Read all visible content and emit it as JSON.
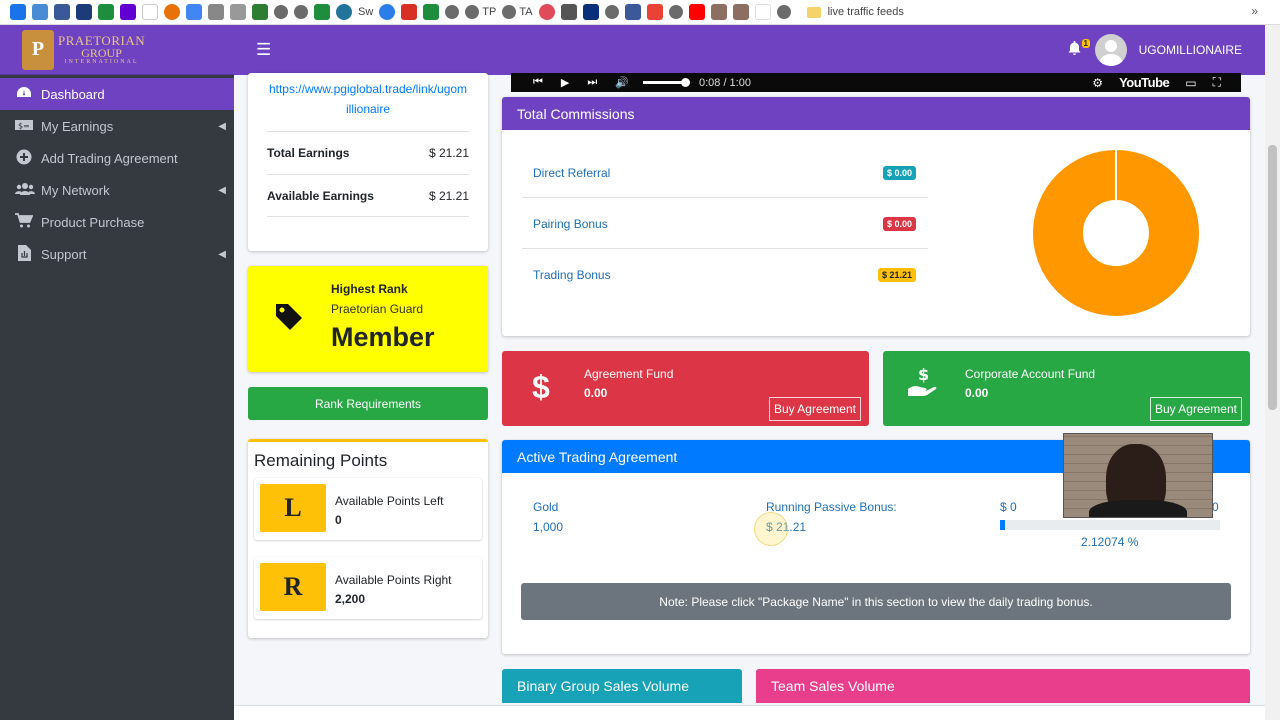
{
  "bookmarks": {
    "items": [
      "Sw",
      "TP",
      "TA",
      "live traffic feeds"
    ]
  },
  "brand": {
    "logo_letter": "P",
    "line1": "PRAETORIAN",
    "line2": "GROUP",
    "line3": "INTERNATIONAL"
  },
  "sidebar": {
    "items": [
      {
        "label": "Dashboard",
        "icon": "dashboard-icon"
      },
      {
        "label": "My Earnings",
        "icon": "money-icon"
      },
      {
        "label": "Add Trading Agreement",
        "icon": "plus-circle-icon"
      },
      {
        "label": "My Network",
        "icon": "users-icon"
      },
      {
        "label": "Product Purchase",
        "icon": "cart-icon"
      },
      {
        "label": "Support",
        "icon": "file-icon"
      }
    ]
  },
  "topbar": {
    "notification_count": "1",
    "username": "UGOMILLIONAIRE"
  },
  "earnings": {
    "referral_link": "https://www.pgiglobal.trade/link/ugomillionaire",
    "total_label": "Total Earnings",
    "total_value": "$ 21.21",
    "available_label": "Available Earnings",
    "available_value": "$ 21.21"
  },
  "rank": {
    "title": "Highest Rank",
    "subtitle": "Praetorian Guard",
    "value": "Member",
    "button": "Rank Requirements"
  },
  "points": {
    "title": "Remaining Points",
    "left": {
      "letter": "L",
      "label": "Available Points Left",
      "value": "0"
    },
    "right": {
      "letter": "R",
      "label": "Available Points Right",
      "value": "2,200"
    }
  },
  "video": {
    "time": "0:08 / 1:00",
    "brand": "YouTube"
  },
  "commissions": {
    "title": "Total Commissions",
    "rows": [
      {
        "label": "Direct Referral",
        "value": "$ 0.00",
        "color": "#17a2b8"
      },
      {
        "label": "Pairing Bonus",
        "value": "$ 0.00",
        "color": "#dc3545"
      },
      {
        "label": "Trading Bonus",
        "value": "$ 21.21",
        "color": "#ffc107"
      }
    ],
    "donut": {
      "trading_bonus_fraction": 0.995,
      "color": "#ff9800"
    }
  },
  "funds": {
    "agreement": {
      "label": "Agreement Fund",
      "value": "0.00",
      "button": "Buy Agreement",
      "color": "#dc3545"
    },
    "corporate": {
      "label": "Corporate Account Fund",
      "value": "0.00",
      "button": "Buy Agreement",
      "color": "#28a745"
    }
  },
  "trading": {
    "title": "Active Trading Agreement",
    "package": "Gold",
    "package_value": "1,000",
    "bonus_label": "Running Passive Bonus:",
    "bonus_value": "$ 21.21",
    "range_start": "$ 0",
    "range_end": "0",
    "percent_text": "2.12074 %",
    "progress_fraction": 0.0212074,
    "note": "Note: Please click \"Package Name\" in this section to view the daily trading bonus."
  },
  "bottom": {
    "binary": "Binary Group Sales Volume",
    "team": "Team Sales Volume"
  }
}
